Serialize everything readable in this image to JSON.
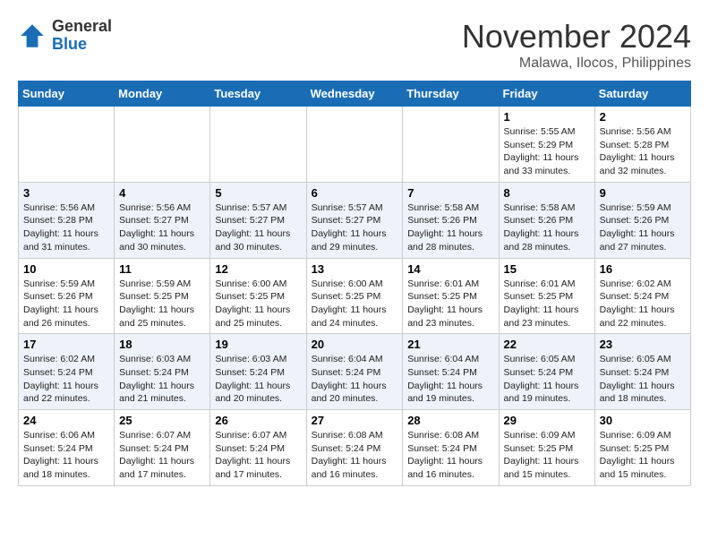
{
  "header": {
    "logo_general": "General",
    "logo_blue": "Blue",
    "month_title": "November 2024",
    "location": "Malawa, Ilocos, Philippines"
  },
  "weekdays": [
    "Sunday",
    "Monday",
    "Tuesday",
    "Wednesday",
    "Thursday",
    "Friday",
    "Saturday"
  ],
  "weeks": [
    [
      {
        "day": "",
        "info": ""
      },
      {
        "day": "",
        "info": ""
      },
      {
        "day": "",
        "info": ""
      },
      {
        "day": "",
        "info": ""
      },
      {
        "day": "",
        "info": ""
      },
      {
        "day": "1",
        "info": "Sunrise: 5:55 AM\nSunset: 5:29 PM\nDaylight: 11 hours and 33 minutes."
      },
      {
        "day": "2",
        "info": "Sunrise: 5:56 AM\nSunset: 5:28 PM\nDaylight: 11 hours and 32 minutes."
      }
    ],
    [
      {
        "day": "3",
        "info": "Sunrise: 5:56 AM\nSunset: 5:28 PM\nDaylight: 11 hours and 31 minutes."
      },
      {
        "day": "4",
        "info": "Sunrise: 5:56 AM\nSunset: 5:27 PM\nDaylight: 11 hours and 30 minutes."
      },
      {
        "day": "5",
        "info": "Sunrise: 5:57 AM\nSunset: 5:27 PM\nDaylight: 11 hours and 30 minutes."
      },
      {
        "day": "6",
        "info": "Sunrise: 5:57 AM\nSunset: 5:27 PM\nDaylight: 11 hours and 29 minutes."
      },
      {
        "day": "7",
        "info": "Sunrise: 5:58 AM\nSunset: 5:26 PM\nDaylight: 11 hours and 28 minutes."
      },
      {
        "day": "8",
        "info": "Sunrise: 5:58 AM\nSunset: 5:26 PM\nDaylight: 11 hours and 28 minutes."
      },
      {
        "day": "9",
        "info": "Sunrise: 5:59 AM\nSunset: 5:26 PM\nDaylight: 11 hours and 27 minutes."
      }
    ],
    [
      {
        "day": "10",
        "info": "Sunrise: 5:59 AM\nSunset: 5:26 PM\nDaylight: 11 hours and 26 minutes."
      },
      {
        "day": "11",
        "info": "Sunrise: 5:59 AM\nSunset: 5:25 PM\nDaylight: 11 hours and 25 minutes."
      },
      {
        "day": "12",
        "info": "Sunrise: 6:00 AM\nSunset: 5:25 PM\nDaylight: 11 hours and 25 minutes."
      },
      {
        "day": "13",
        "info": "Sunrise: 6:00 AM\nSunset: 5:25 PM\nDaylight: 11 hours and 24 minutes."
      },
      {
        "day": "14",
        "info": "Sunrise: 6:01 AM\nSunset: 5:25 PM\nDaylight: 11 hours and 23 minutes."
      },
      {
        "day": "15",
        "info": "Sunrise: 6:01 AM\nSunset: 5:25 PM\nDaylight: 11 hours and 23 minutes."
      },
      {
        "day": "16",
        "info": "Sunrise: 6:02 AM\nSunset: 5:24 PM\nDaylight: 11 hours and 22 minutes."
      }
    ],
    [
      {
        "day": "17",
        "info": "Sunrise: 6:02 AM\nSunset: 5:24 PM\nDaylight: 11 hours and 22 minutes."
      },
      {
        "day": "18",
        "info": "Sunrise: 6:03 AM\nSunset: 5:24 PM\nDaylight: 11 hours and 21 minutes."
      },
      {
        "day": "19",
        "info": "Sunrise: 6:03 AM\nSunset: 5:24 PM\nDaylight: 11 hours and 20 minutes."
      },
      {
        "day": "20",
        "info": "Sunrise: 6:04 AM\nSunset: 5:24 PM\nDaylight: 11 hours and 20 minutes."
      },
      {
        "day": "21",
        "info": "Sunrise: 6:04 AM\nSunset: 5:24 PM\nDaylight: 11 hours and 19 minutes."
      },
      {
        "day": "22",
        "info": "Sunrise: 6:05 AM\nSunset: 5:24 PM\nDaylight: 11 hours and 19 minutes."
      },
      {
        "day": "23",
        "info": "Sunrise: 6:05 AM\nSunset: 5:24 PM\nDaylight: 11 hours and 18 minutes."
      }
    ],
    [
      {
        "day": "24",
        "info": "Sunrise: 6:06 AM\nSunset: 5:24 PM\nDaylight: 11 hours and 18 minutes."
      },
      {
        "day": "25",
        "info": "Sunrise: 6:07 AM\nSunset: 5:24 PM\nDaylight: 11 hours and 17 minutes."
      },
      {
        "day": "26",
        "info": "Sunrise: 6:07 AM\nSunset: 5:24 PM\nDaylight: 11 hours and 17 minutes."
      },
      {
        "day": "27",
        "info": "Sunrise: 6:08 AM\nSunset: 5:24 PM\nDaylight: 11 hours and 16 minutes."
      },
      {
        "day": "28",
        "info": "Sunrise: 6:08 AM\nSunset: 5:24 PM\nDaylight: 11 hours and 16 minutes."
      },
      {
        "day": "29",
        "info": "Sunrise: 6:09 AM\nSunset: 5:25 PM\nDaylight: 11 hours and 15 minutes."
      },
      {
        "day": "30",
        "info": "Sunrise: 6:09 AM\nSunset: 5:25 PM\nDaylight: 11 hours and 15 minutes."
      }
    ]
  ]
}
